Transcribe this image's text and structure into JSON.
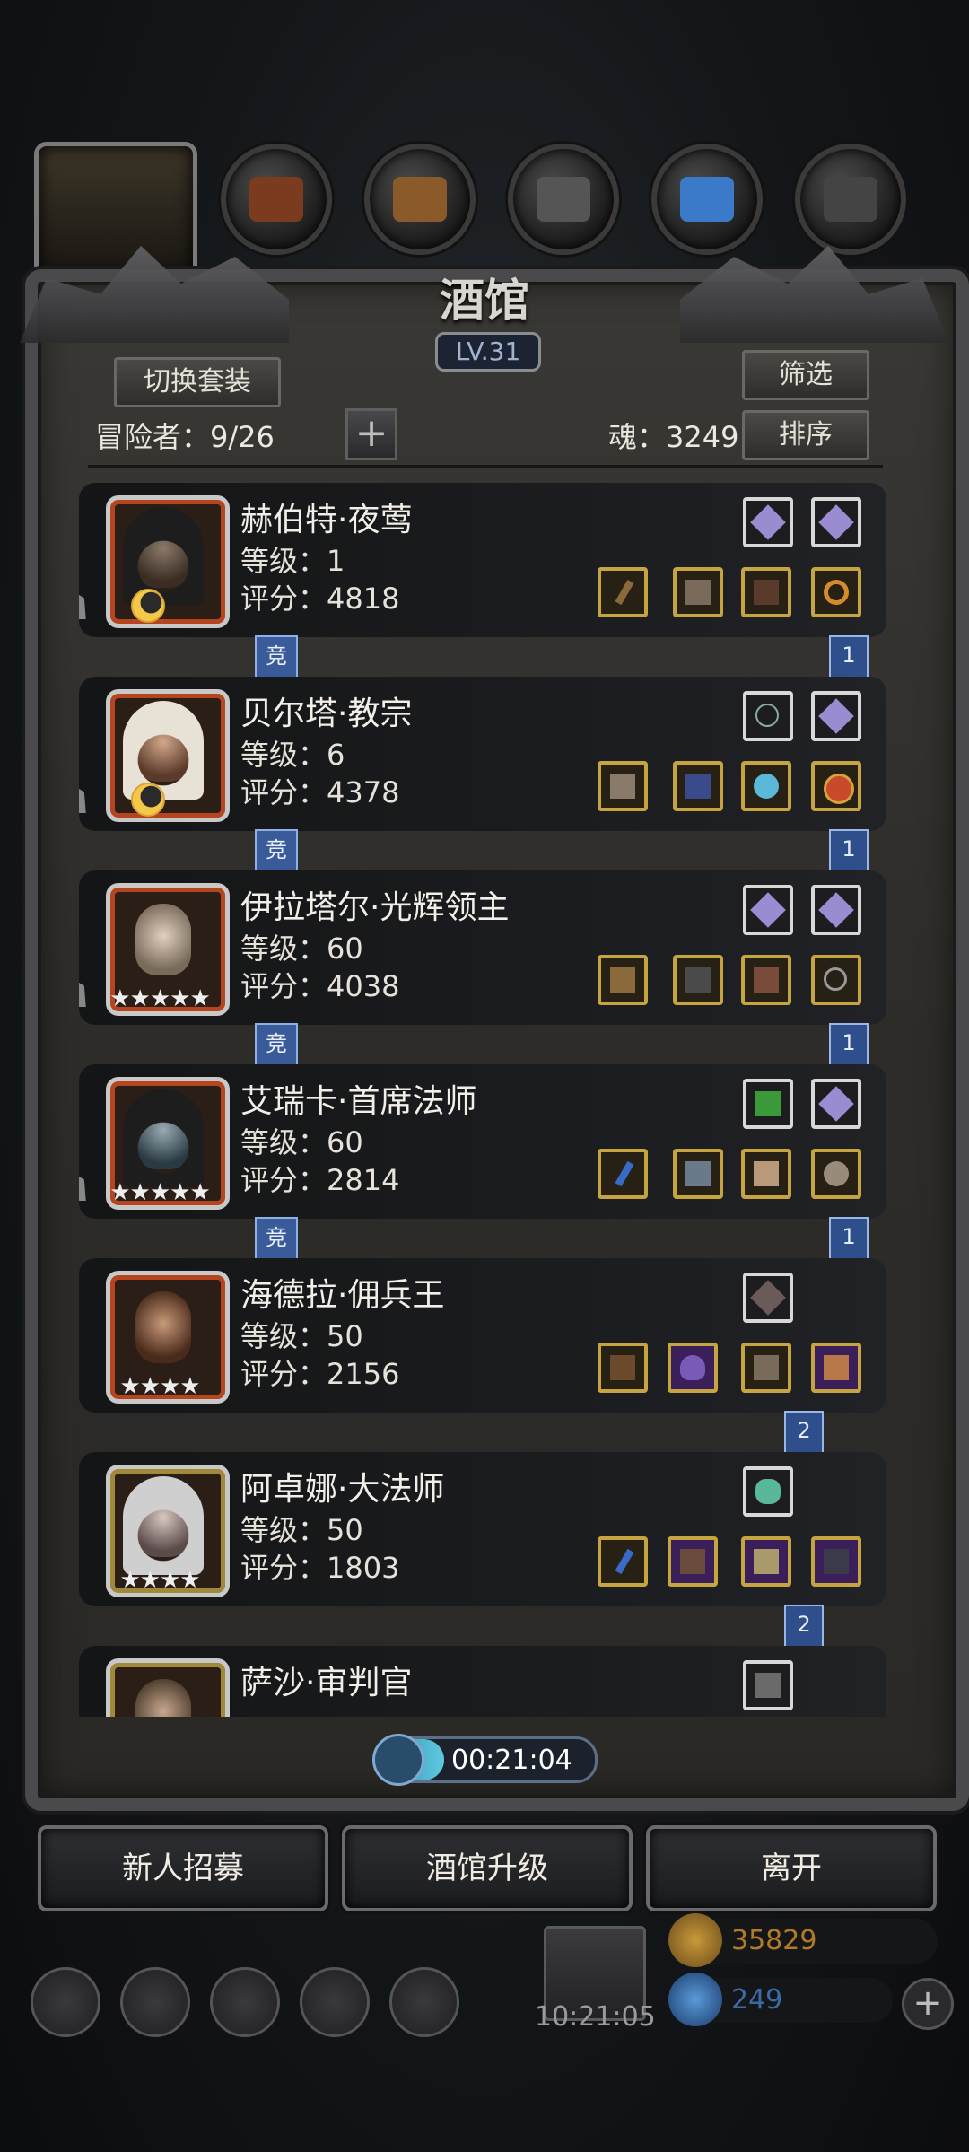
{
  "title": "酒馆",
  "level": "LV.31",
  "buttons": {
    "switch_outfit": "切换套装",
    "filter": "筛选",
    "sort": "排序",
    "recruit": "新人招募",
    "upgrade": "酒馆升级",
    "leave": "离开"
  },
  "adventurers_label": "冒险者：9/26",
  "soul_label": "魂：3249",
  "timer": "00:21:04",
  "clock": "10:21:05",
  "resources": {
    "gold": "35829",
    "gems": "249"
  },
  "heroes": [
    {
      "name": "赫伯特·夜莺",
      "level": "等级：1",
      "score": "评分：4818",
      "rank": "1",
      "jing": "竞",
      "rarity": "moon"
    },
    {
      "name": "贝尔塔·教宗",
      "level": "等级：6",
      "score": "评分：4378",
      "rank": "1",
      "jing": "竞",
      "rarity": "moon"
    },
    {
      "name": "伊拉塔尔·光辉领主",
      "level": "等级：60",
      "score": "评分：4038",
      "rank": "1",
      "jing": "竞",
      "stars": "★★★★★"
    },
    {
      "name": "艾瑞卡·首席法师",
      "level": "等级：60",
      "score": "评分：2814",
      "rank": "1",
      "jing": "竞",
      "stars": "★★★★★"
    },
    {
      "name": "海德拉·佣兵王",
      "level": "等级：50",
      "score": "评分：2156",
      "rank": "2",
      "stars": "★★★★"
    },
    {
      "name": "阿卓娜·大法师",
      "level": "等级：50",
      "score": "评分：1803",
      "rank": "2",
      "stars": "★★★★"
    },
    {
      "name": "萨沙·审判官"
    }
  ],
  "colors": {
    "gold_border": "#c6a540",
    "purple_slot": "#3a1f5a",
    "rank_blue": "#2f4e8c"
  }
}
